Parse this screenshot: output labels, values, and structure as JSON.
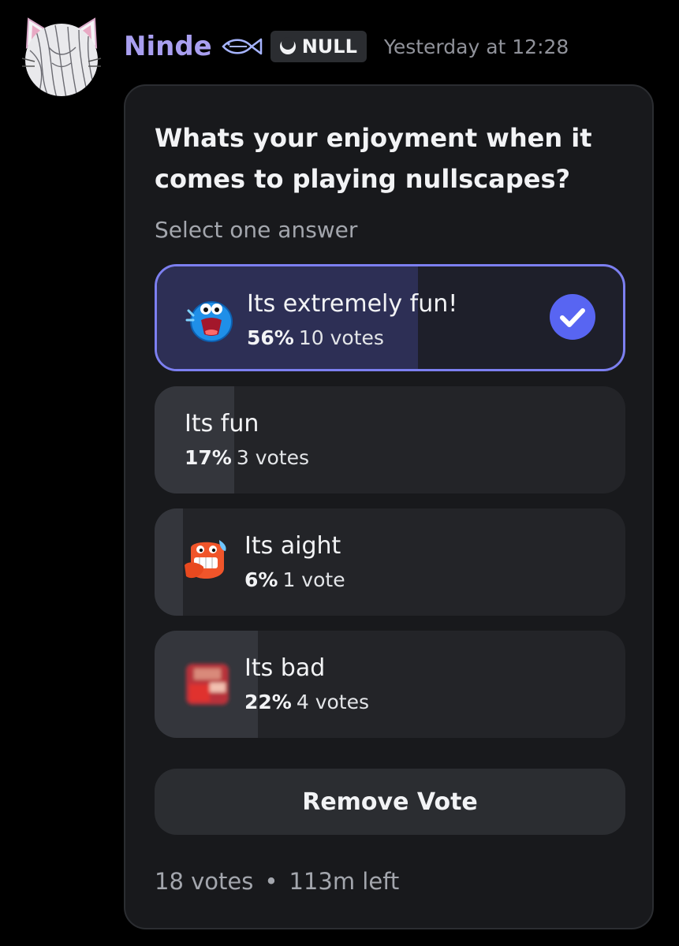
{
  "message": {
    "username": "Ninde",
    "tag": "NULL",
    "timestamp": "Yesterday at 12:28",
    "username_color": "#a99ff0"
  },
  "poll": {
    "question": "Whats your enjoyment when it comes to playing nullscapes?",
    "hint": "Select one answer",
    "answers": [
      {
        "label": "Its extremely fun!",
        "percent": "56%",
        "votes": "10 votes",
        "fraction": 0.56,
        "selected": true,
        "emoji": "screaming-blue-blob-emoji"
      },
      {
        "label": "Its fun",
        "percent": "17%",
        "votes": "3 votes",
        "fraction": 0.17,
        "selected": false,
        "emoji": ""
      },
      {
        "label": "Its aight",
        "percent": "6%",
        "votes": "1 vote",
        "fraction": 0.06,
        "selected": false,
        "emoji": "grimacing-orange-blob-emoji"
      },
      {
        "label": "Its bad",
        "percent": "22%",
        "votes": "4 votes",
        "fraction": 0.22,
        "selected": false,
        "emoji": "blurred-red-emoji"
      }
    ],
    "remove_vote_label": "Remove Vote",
    "total_votes": "18 votes",
    "separator": "•",
    "time_left": "113m left",
    "accent_color": "#7c7ff0"
  }
}
